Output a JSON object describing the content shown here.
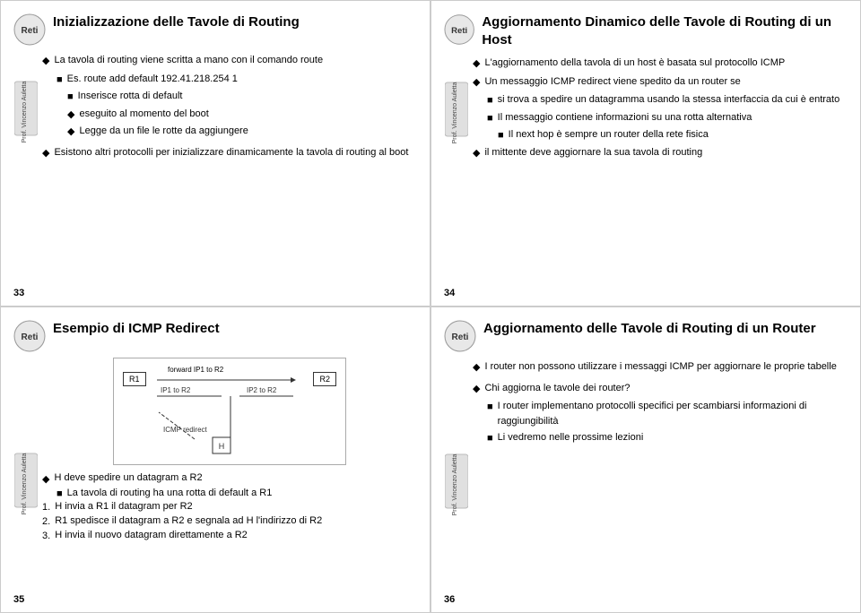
{
  "slides": [
    {
      "id": "slide-33",
      "number": "33",
      "title": "Inizializzazione delle Tavole di Routing",
      "bullets": [
        {
          "sym": "◆",
          "text": "La tavola di routing viene scritta a mano con il comando route",
          "subs": [
            {
              "sym": "■",
              "text": "Es. route add default 192.41.218.254 1"
            },
            {
              "sym": "■",
              "text": "Inserisce rotta di default"
            },
            {
              "sym": "◆",
              "text": "eseguito al momento del boot"
            },
            {
              "sym": "◆",
              "text": "Legge da un file le rotte da aggiungere"
            }
          ]
        },
        {
          "sym": "◆",
          "text": "Esistono altri protocolli per inizializzare dinamicamente la tavola di routing al boot",
          "subs": []
        }
      ]
    },
    {
      "id": "slide-34",
      "number": "34",
      "title": "Aggiornamento Dinamico delle Tavole di Routing di un Host",
      "bullets": [
        {
          "sym": "◆",
          "text": "L'aggiornamento della tavola di un host è basata sul protocollo ICMP",
          "subs": []
        },
        {
          "sym": "◆",
          "text": "Un messaggio ICMP redirect viene spedito da un router se",
          "subs": [
            {
              "sym": "■",
              "text": "si trova a spedire un datagramma usando la stessa interfaccia da cui è entrato"
            },
            {
              "sym": "■",
              "text": "Il messaggio contiene informazioni su una rotta alternativa",
              "subsubs": [
                {
                  "sym": "■",
                  "text": "Il next hop è sempre un router della rete fisica"
                }
              ]
            }
          ]
        },
        {
          "sym": "◆",
          "text": "il mittente deve aggiornare la sua tavola di routing",
          "subs": []
        }
      ]
    },
    {
      "id": "slide-35",
      "number": "35",
      "title": "Esempio di ICMP Redirect",
      "diagram": {
        "r1_label": "R1",
        "r2_label": "R2",
        "forward_label": "forward IP1 to R2",
        "ip1_label": "IP1 to R2",
        "ip2_label": "IP2 to R2",
        "icmp_label": "ICMP redirect",
        "h_label": "H"
      },
      "bullets": [
        {
          "sym": "◆",
          "text": "H deve spedire un datagram a R2",
          "subs": [
            {
              "sym": "■",
              "text": "La tavola di routing ha una rotta di default a R1"
            }
          ]
        },
        {
          "sym": "1.",
          "text": "H invia a R1 il datagram per R2",
          "subs": []
        },
        {
          "sym": "2.",
          "text": "R1 spedisce il datagram a R2 e segnala ad H l'indirizzo di R2",
          "subs": []
        },
        {
          "sym": "3.",
          "text": "H invia il nuovo datagram direttamente a R2",
          "subs": []
        }
      ]
    },
    {
      "id": "slide-36",
      "number": "36",
      "title": "Aggiornamento delle Tavole di Routing di un Router",
      "bullets": [
        {
          "sym": "◆",
          "text": "I router non possono utilizzare i messaggi ICMP per aggiornare le proprie tabelle",
          "subs": []
        },
        {
          "sym": "◆",
          "text": "Chi aggiorna le tavole dei router?",
          "subs": [
            {
              "sym": "■",
              "text": "I router implementano protocolli specifici per scambiarsi informazioni di raggiungibilità"
            },
            {
              "sym": "■",
              "text": "Li vedremo nelle prossime lezioni"
            }
          ]
        }
      ]
    }
  ]
}
